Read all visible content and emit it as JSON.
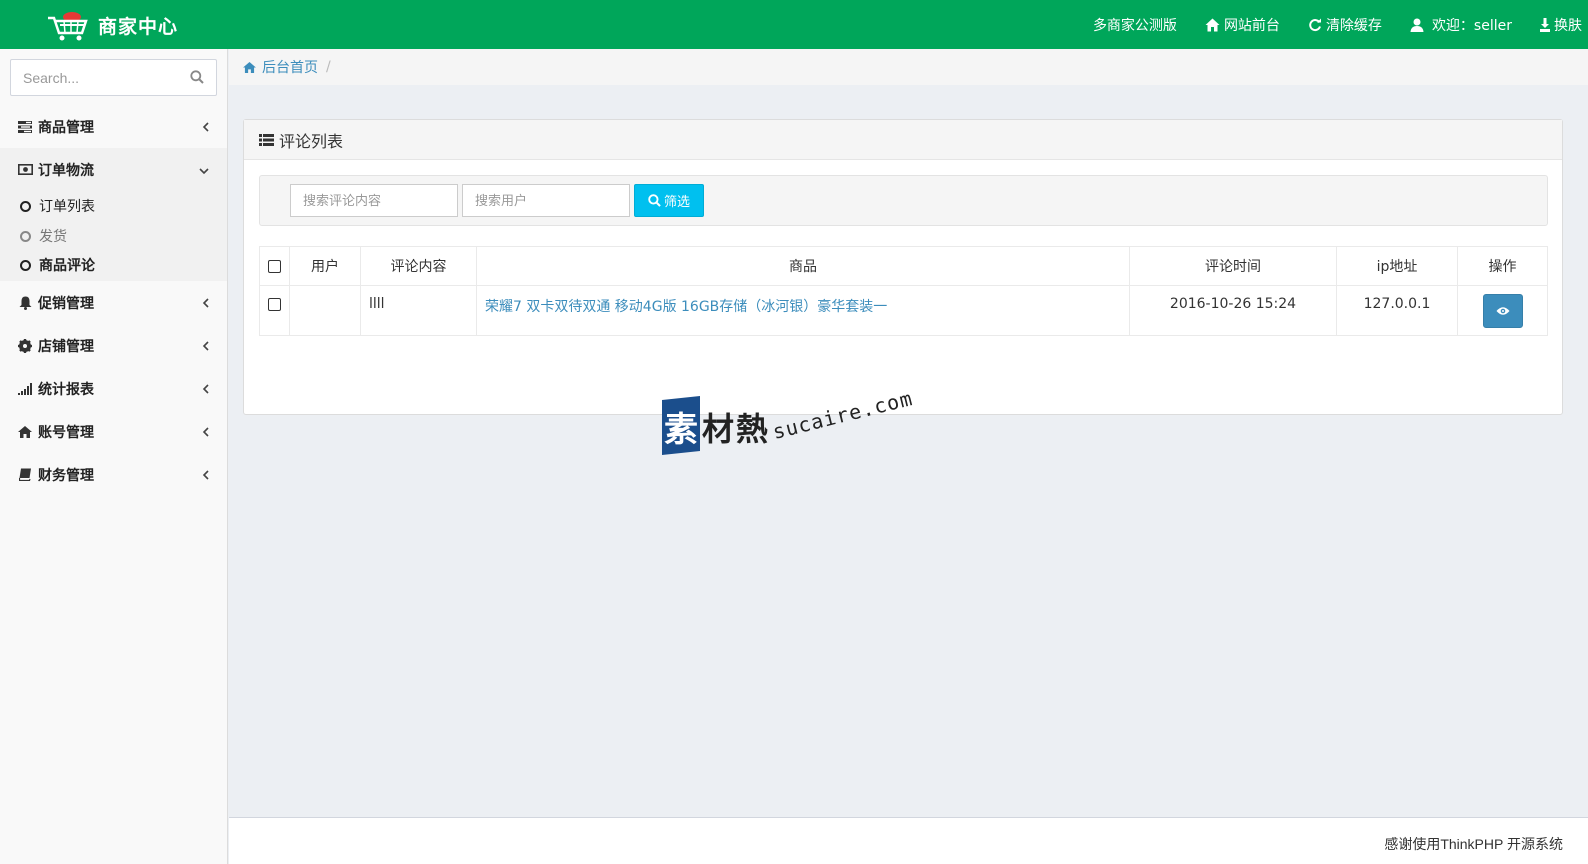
{
  "header": {
    "brand_title": "商家中心",
    "nav": [
      {
        "label": "多商家公测版",
        "icon": "none"
      },
      {
        "label": "网站前台",
        "icon": "home-icon"
      },
      {
        "label": "清除缓存",
        "icon": "refresh-icon"
      },
      {
        "label": "欢迎：seller",
        "icon": "user-icon"
      },
      {
        "label": "换肤",
        "icon": "download-icon"
      }
    ]
  },
  "sidebar": {
    "search_placeholder": "Search...",
    "menu": [
      {
        "label": "商品管理",
        "icon": "tasks-icon",
        "expanded": false
      },
      {
        "label": "订单物流",
        "icon": "money-icon",
        "expanded": true,
        "children": [
          {
            "label": "订单列表",
            "state": "normal"
          },
          {
            "label": "发货",
            "state": "muted"
          },
          {
            "label": "商品评论",
            "state": "active"
          }
        ]
      },
      {
        "label": "促销管理",
        "icon": "bell-icon",
        "expanded": false
      },
      {
        "label": "店铺管理",
        "icon": "gear-icon",
        "expanded": false
      },
      {
        "label": "统计报表",
        "icon": "signal-icon",
        "expanded": false
      },
      {
        "label": "账号管理",
        "icon": "home-icon",
        "expanded": false
      },
      {
        "label": "财务管理",
        "icon": "book-icon",
        "expanded": false
      }
    ]
  },
  "breadcrumb": {
    "home": "后台首页",
    "separator": "/"
  },
  "panel": {
    "title": "评论列表",
    "filter": {
      "content_placeholder": "搜索评论内容",
      "user_placeholder": "搜索用户",
      "button_label": "筛选"
    },
    "table": {
      "columns": [
        "用户",
        "评论内容",
        "商品",
        "评论时间",
        "ip地址",
        "操作"
      ],
      "rows": [
        {
          "user": "",
          "content": "llll",
          "product": "荣耀7 双卡双待双通 移动4G版 16GB存储（冰河银）豪华套装一",
          "time": "2016-10-26 15:24",
          "ip": "127.0.0.1"
        }
      ]
    }
  },
  "watermark": {
    "char1": "素",
    "chars": "材熱",
    "url": "sucaire.com"
  },
  "footer": {
    "text": "感谢使用ThinkPHP 开源系统"
  },
  "colors": {
    "header": "#00a65a",
    "link": "#3c8dbc",
    "filter_button": "#00c0ef",
    "view_button": "#3c8dbc"
  }
}
